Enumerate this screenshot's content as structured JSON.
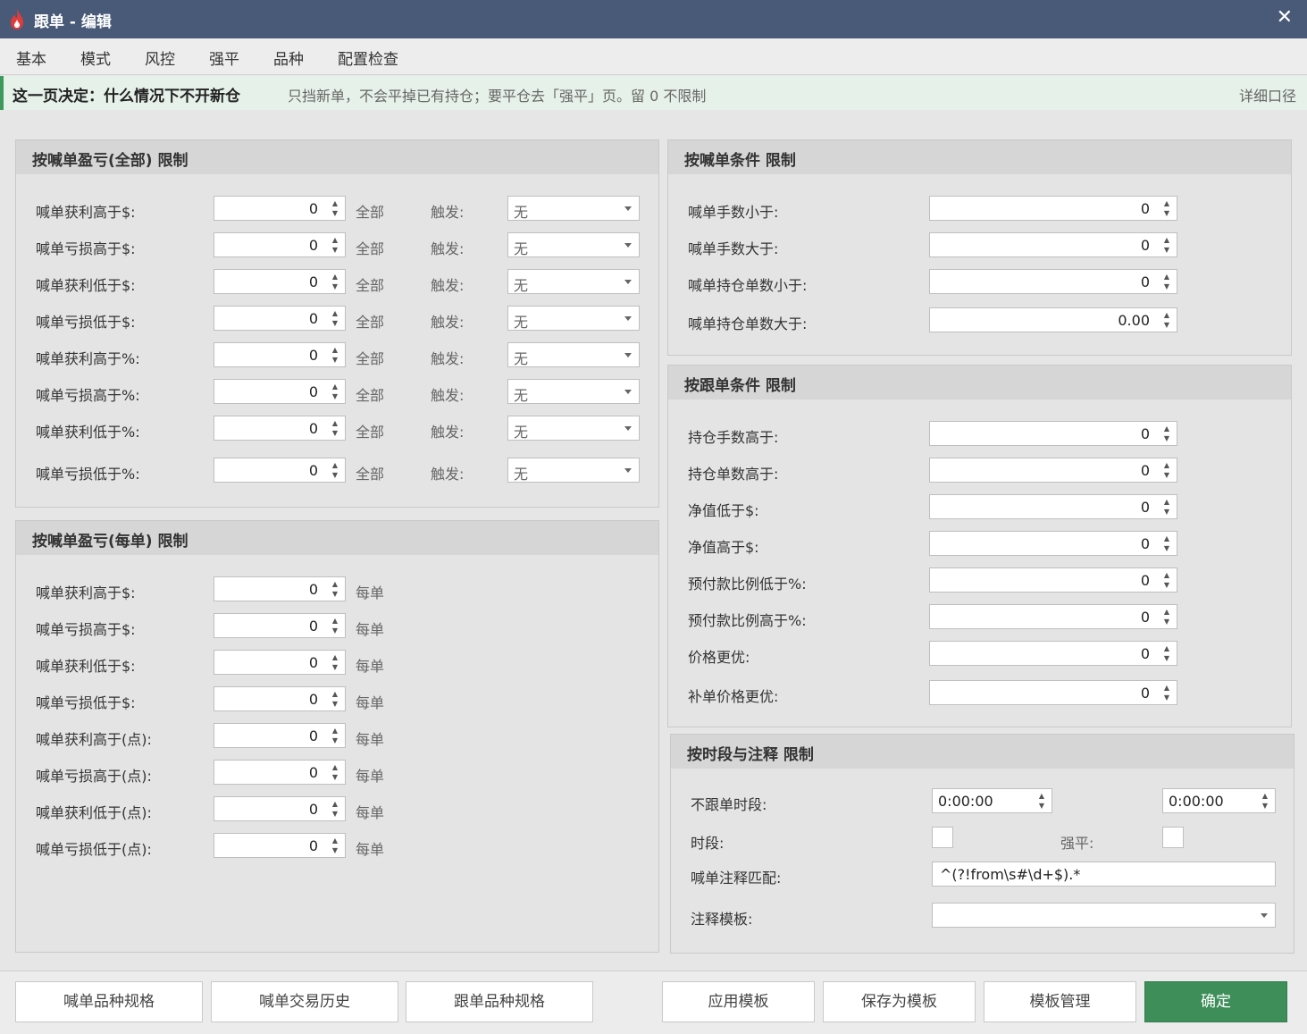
{
  "window": {
    "title": "跟单 - 编辑",
    "close_glyph": "✕",
    "icon": "flame-icon"
  },
  "tabs": [
    "基本",
    "模式",
    "风控",
    "强平",
    "品种",
    "配置检查"
  ],
  "active_tab": "风控",
  "banner": {
    "headline": "这一页决定：什么情况下不开新仓",
    "note": "只挡新单，不会平掉已有持仓；要平仓去「强平」页。留 0 不限制",
    "link": "详细口径",
    "accent_color": "#3e9a5c"
  },
  "panel_all": {
    "header": "按喊单盈亏(全部) 限制",
    "rows": [
      {
        "label": "喊单获利高于$:",
        "value": "0",
        "unit": "全部",
        "trigger_label": "触发:",
        "trigger": "无"
      },
      {
        "label": "喊单亏损高于$:",
        "value": "0",
        "unit": "全部",
        "trigger_label": "触发:",
        "trigger": "无"
      },
      {
        "label": "喊单获利低于$:",
        "value": "0",
        "unit": "全部",
        "trigger_label": "触发:",
        "trigger": "无"
      },
      {
        "label": "喊单亏损低于$:",
        "value": "0",
        "unit": "全部",
        "trigger_label": "触发:",
        "trigger": "无"
      },
      {
        "label": "喊单获利高于%:",
        "value": "0",
        "unit": "全部",
        "trigger_label": "触发:",
        "trigger": "无"
      },
      {
        "label": "喊单亏损高于%:",
        "value": "0",
        "unit": "全部",
        "trigger_label": "触发:",
        "trigger": "无"
      },
      {
        "label": "喊单获利低于%:",
        "value": "0",
        "unit": "全部",
        "trigger_label": "触发:",
        "trigger": "无"
      },
      {
        "label": "喊单亏损低于%:",
        "value": "0",
        "unit": "全部",
        "trigger_label": "触发:",
        "trigger": "无"
      }
    ]
  },
  "panel_each": {
    "header": "按喊单盈亏(每单) 限制",
    "rows": [
      {
        "label": "喊单获利高于$:",
        "value": "0",
        "unit": "每单"
      },
      {
        "label": "喊单亏损高于$:",
        "value": "0",
        "unit": "每单"
      },
      {
        "label": "喊单获利低于$:",
        "value": "0",
        "unit": "每单"
      },
      {
        "label": "喊单亏损低于$:",
        "value": "0",
        "unit": "每单"
      },
      {
        "label": "喊单获利高于(点):",
        "value": "0",
        "unit": "每单"
      },
      {
        "label": "喊单亏损高于(点):",
        "value": "0",
        "unit": "每单"
      },
      {
        "label": "喊单获利低于(点):",
        "value": "0",
        "unit": "每单"
      },
      {
        "label": "喊单亏损低于(点):",
        "value": "0",
        "unit": "每单"
      }
    ]
  },
  "panel_caller": {
    "header": "按喊单条件 限制",
    "rows": [
      {
        "label": "喊单手数小于:",
        "value": "0"
      },
      {
        "label": "喊单手数大于:",
        "value": "0"
      },
      {
        "label": "喊单持仓单数小于:",
        "value": "0"
      },
      {
        "label": "喊单持仓单数大于:",
        "value": "0.00"
      }
    ]
  },
  "panel_follower": {
    "header": "按跟单条件 限制",
    "rows": [
      {
        "label": "持仓手数高于:",
        "value": "0"
      },
      {
        "label": "持仓单数高于:",
        "value": "0"
      },
      {
        "label": "净值低于$:",
        "value": "0"
      },
      {
        "label": "净值高于$:",
        "value": "0"
      },
      {
        "label": "预付款比例低于%:",
        "value": "0"
      },
      {
        "label": "预付款比例高于%:",
        "value": "0"
      },
      {
        "label": "价格更优:",
        "value": "0"
      },
      {
        "label": "补单价格更优:",
        "value": "0"
      }
    ]
  },
  "panel_time": {
    "header": "按时段与注释 限制",
    "no_follow_label": "不跟单时段:",
    "time_start": "0:00:00",
    "time_end": "0:00:00",
    "period_label": "时段:",
    "force_label": "强平:",
    "comment_label": "喊单注释匹配:",
    "comment_value": "^(?!from\\s#\\d+$).*",
    "template_label": "注释模板:",
    "template_value": ""
  },
  "footer": {
    "caller_spec": "喊单品种规格",
    "caller_history": "喊单交易历史",
    "follower_spec": "跟单品种规格",
    "apply_template": "应用模板",
    "save_template": "保存为模板",
    "template_manage": "模板管理",
    "confirm": "确定",
    "confirm_color": "#3d8e59"
  }
}
